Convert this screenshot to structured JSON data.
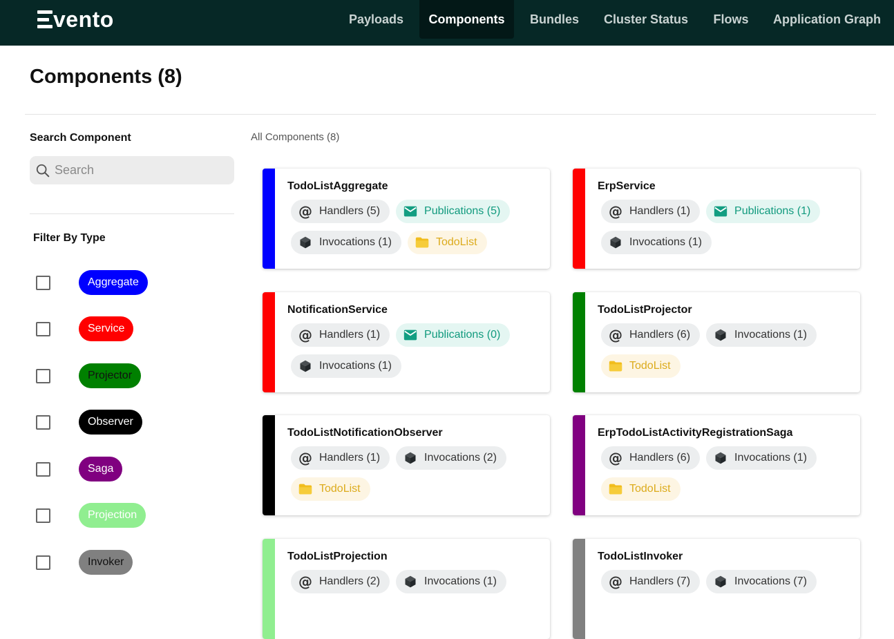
{
  "nav": {
    "brand": "vento",
    "items": [
      "Payloads",
      "Components",
      "Bundles",
      "Cluster Status",
      "Flows",
      "Application Graph"
    ],
    "active": "Components"
  },
  "page": {
    "title": "Components (8)"
  },
  "sidebar": {
    "search_label": "Search Component",
    "search_placeholder": "Search",
    "filter_label": "Filter By Type",
    "types": [
      {
        "label": "Aggregate",
        "color": "#0000ff",
        "text_color": "#ffffff"
      },
      {
        "label": "Service",
        "color": "#ff0000",
        "text_color": "#ffffff"
      },
      {
        "label": "Projector",
        "color": "#008000",
        "text_color": "#111111"
      },
      {
        "label": "Observer",
        "color": "#000000",
        "text_color": "#ffffff"
      },
      {
        "label": "Saga",
        "color": "#800080",
        "text_color": "#ffffff"
      },
      {
        "label": "Projection",
        "color": "#90ee90",
        "text_color": "#ffffff"
      },
      {
        "label": "Invoker",
        "color": "#808080",
        "text_color": "#111111"
      }
    ]
  },
  "main": {
    "all_label": "All Components (8)",
    "components": [
      {
        "name": "TodoListAggregate",
        "color": "#0000ff",
        "handlers": "Handlers (5)",
        "publications": "Publications (5)",
        "invocations": "Invocations (1)",
        "context": "TodoList"
      },
      {
        "name": "ErpService",
        "color": "#ff0000",
        "handlers": "Handlers (1)",
        "publications": "Publications (1)",
        "invocations": "Invocations (1)"
      },
      {
        "name": "NotificationService",
        "color": "#ff0000",
        "handlers": "Handlers (1)",
        "publications": "Publications (0)",
        "invocations": "Invocations (1)"
      },
      {
        "name": "TodoListProjector",
        "color": "#008000",
        "handlers": "Handlers (6)",
        "invocations": "Invocations (1)",
        "context": "TodoList"
      },
      {
        "name": "TodoListNotificationObserver",
        "color": "#000000",
        "handlers": "Handlers (1)",
        "invocations": "Invocations (2)",
        "context": "TodoList"
      },
      {
        "name": "ErpTodoListActivityRegistrationSaga",
        "color": "#800080",
        "handlers": "Handlers (6)",
        "invocations": "Invocations (1)",
        "context": "TodoList"
      },
      {
        "name": "TodoListProjection",
        "color": "#90ee90",
        "handlers": "Handlers (2)",
        "invocations": "Invocations (1)"
      },
      {
        "name": "TodoListInvoker",
        "color": "#808080",
        "handlers": "Handlers (7)",
        "invocations": "Invocations (7)"
      }
    ]
  }
}
